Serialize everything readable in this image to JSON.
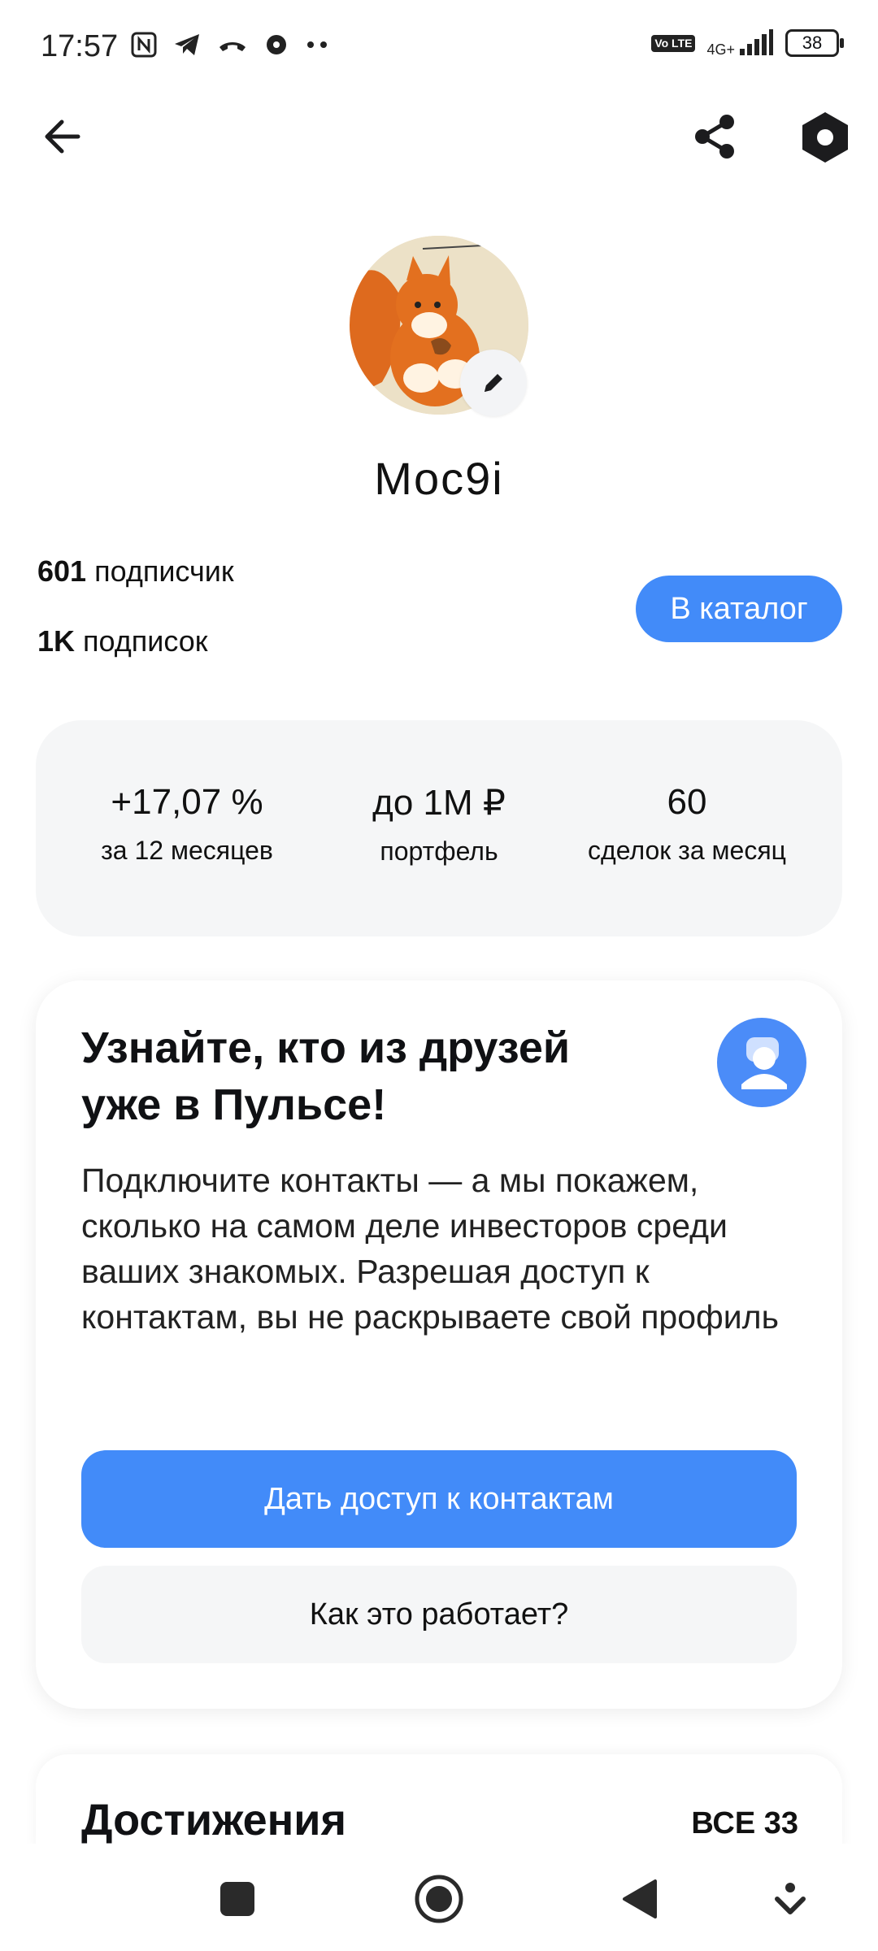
{
  "status_bar": {
    "time": "17:57",
    "network": "4G+",
    "battery": "38",
    "volte": "Vo LTE"
  },
  "header": {
    "back_icon": "arrow-left-icon",
    "share_icon": "share-icon",
    "settings_icon": "hexagon-gear-icon"
  },
  "profile": {
    "username": "Moc9i",
    "followers_count": "601",
    "followers_label": "подписчик",
    "following_count": "1K",
    "following_label": "подписок",
    "catalog_button": "В каталог"
  },
  "metrics": [
    {
      "value": "+17,07 %",
      "label": "за 12 месяцев"
    },
    {
      "value": "до 1M ₽",
      "label": "портфель"
    },
    {
      "value": "60",
      "label": "сделок за месяц"
    }
  ],
  "contacts_card": {
    "title": "Узнайте, кто из друзей уже в Пульсе!",
    "text": "Подключите контакты — а мы покажем, сколько на самом деле инвесторов среди ваших знакомых. Разрешая доступ к контактам, вы не раскрываете свой профиль",
    "primary_button": "Дать доступ к контактам",
    "secondary_button": "Как это работает?"
  },
  "achievements": {
    "title": "Достижения",
    "all_link": "ВСЕ 33"
  },
  "colors": {
    "accent": "#428bf9",
    "card_bg": "#f5f6f7"
  }
}
